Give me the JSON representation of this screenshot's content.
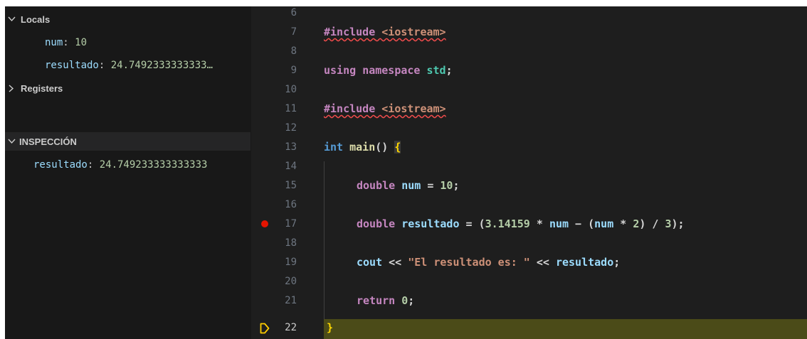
{
  "sidebar": {
    "locals": {
      "header": "Locals",
      "vars": [
        {
          "name": "num",
          "value": "10"
        },
        {
          "name": "resultado",
          "value": "24.7492333333333…"
        }
      ]
    },
    "registers": {
      "header": "Registers"
    },
    "watch": {
      "header": "INSPECCIÓN",
      "vars": [
        {
          "name": "resultado",
          "value": "24.749233333333333"
        }
      ]
    },
    "separator": ": "
  },
  "editor": {
    "line_numbers": [
      "6",
      "7",
      "8",
      "9",
      "10",
      "11",
      "12",
      "13",
      "14",
      "15",
      "16",
      "17",
      "18",
      "19",
      "20",
      "21",
      "22"
    ],
    "breakpoint_line": "17",
    "current_line": "22",
    "code": {
      "l7": [
        "#include",
        " ",
        "<iostream>"
      ],
      "l9": [
        "using",
        " ",
        "namespace",
        " ",
        "std",
        ";"
      ],
      "l11": [
        "#include",
        " ",
        "<iostream>"
      ],
      "l13": [
        "int",
        " ",
        "main",
        "()",
        " ",
        "{"
      ],
      "l15": [
        "double",
        " ",
        "num",
        " = ",
        "10",
        ";"
      ],
      "l17": [
        "double",
        " ",
        "resultado",
        " = (",
        "3.14159",
        " * ",
        "num",
        " − (",
        "num",
        " * ",
        "2",
        ") / ",
        "3",
        ");"
      ],
      "l19": [
        "cout",
        " << ",
        "\"El resultado es: \"",
        " << ",
        "resultado",
        ";"
      ],
      "l21": [
        "return",
        " ",
        "0",
        ";"
      ],
      "l22": [
        "}"
      ]
    }
  },
  "colors": {
    "background": "#1e1e1e",
    "sidebar": "#181818",
    "current_line": "#4b4b18",
    "breakpoint": "#e51400",
    "debug_arrow": "#ffcc00"
  }
}
